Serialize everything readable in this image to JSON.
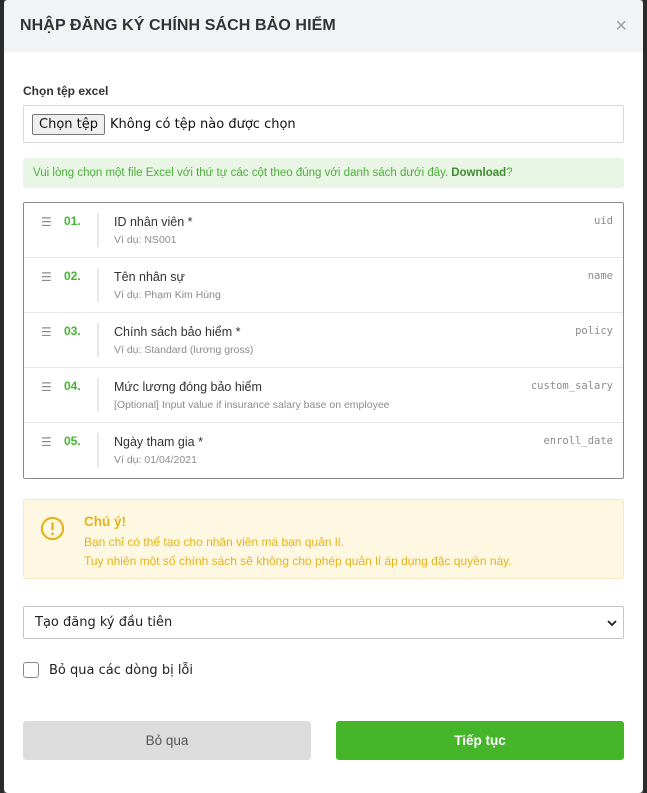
{
  "modal": {
    "title": "NHẬP ĐĂNG KÝ CHÍNH SÁCH BẢO HIỂM",
    "close_icon": "close-icon",
    "file": {
      "label": "Chọn tệp excel",
      "button_label": "Chọn tệp",
      "status": "Không có tệp nào được chọn"
    },
    "hint": {
      "text": "Vui lòng chọn một file Excel với thứ tự các cột theo đúng với danh sách dưới đây.",
      "link": "Download",
      "suffix": "?"
    },
    "columns": [
      {
        "num": "01.",
        "title": "ID nhân viên *",
        "example": "Ví dụ: NS001",
        "key": "uid"
      },
      {
        "num": "02.",
        "title": "Tên nhân sự",
        "example": "Ví dụ: Phạm Kim Hùng",
        "key": "name"
      },
      {
        "num": "03.",
        "title": "Chính sách bảo hiểm *",
        "example": "Ví dụ: Standard (lương gross)",
        "key": "policy"
      },
      {
        "num": "04.",
        "title": "Mức lương đóng bảo hiểm",
        "example": "[Optional] Input value if insurance salary base on employee",
        "key": "custom_salary"
      },
      {
        "num": "05.",
        "title": "Ngày tham gia *",
        "example": "Ví dụ: 01/04/2021",
        "key": "enroll_date"
      }
    ],
    "warning": {
      "title": "Chú ý!",
      "line1": "Bạn chỉ có thể tạo cho nhân viên mà bạn quản lí.",
      "line2": "Tuy nhiên một số chính sách sẽ không cho phép quản lí áp dụng đặc quyền này.",
      "icon": "exclamation-circle-icon"
    },
    "mode_select": {
      "value": "Tạo đăng ký đầu tiên"
    },
    "skip_errors": {
      "label": "Bỏ qua các dòng bị lỗi",
      "checked": false
    },
    "actions": {
      "cancel": "Bỏ qua",
      "continue": "Tiếp tục"
    }
  },
  "colors": {
    "accent_green": "#45b52a",
    "warning_yellow": "#e3b31e",
    "header_bg": "#f2f3f5"
  }
}
